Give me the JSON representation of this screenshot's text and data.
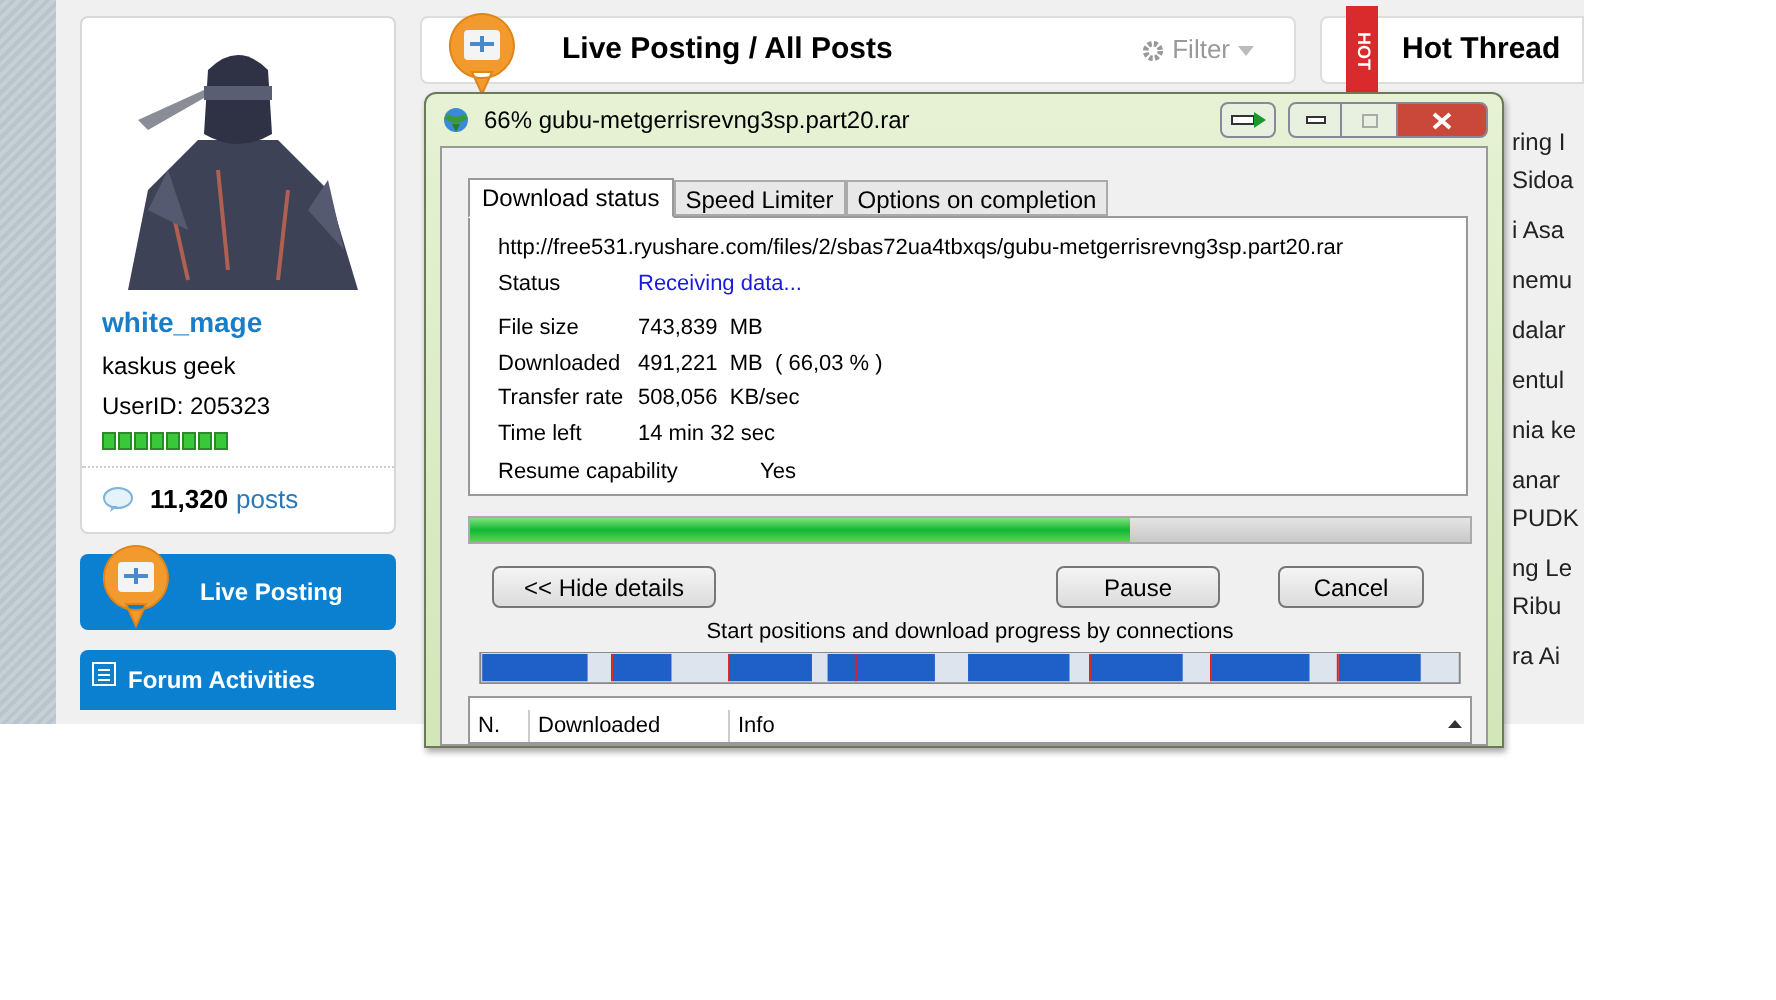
{
  "profile": {
    "username": "white_mage",
    "rank": "kaskus geek",
    "user_id": "UserID: 205323",
    "post_count": "11,320",
    "posts_label": "posts"
  },
  "sidebar_buttons": [
    {
      "label": "Live Posting",
      "kind": "live"
    },
    {
      "label": "Forum Activities",
      "kind": "forum"
    }
  ],
  "live_header": {
    "title": "Live Posting / All Posts",
    "filter": "Filter"
  },
  "hot_threads": {
    "badge": "HOT",
    "title": "Hot Thread",
    "items": [
      [
        "ring I",
        "Sidoa"
      ],
      [
        "i Asa"
      ],
      [
        "nemu"
      ],
      [
        "dalar"
      ],
      [
        "entul"
      ],
      [
        "nia ke"
      ],
      [
        "anar",
        "PUDK"
      ],
      [
        "ng Le",
        "Ribu"
      ],
      [
        "ra Ai"
      ]
    ]
  },
  "download_window": {
    "title": "66% gubu-metgerrisrevng3sp.part20.rar",
    "tabs": [
      {
        "label": "Download status",
        "selected": true
      },
      {
        "label": "Speed Limiter",
        "selected": false
      },
      {
        "label": "Options on completion",
        "selected": false
      }
    ],
    "url": "http://free531.ryushare.com/files/2/sbas72ua4tbxqs/gubu-metgerrisrevng3sp.part20.rar",
    "status_label": "Status",
    "status": "Receiving data...",
    "fields": [
      {
        "label": "File size",
        "value": "743,839  MB"
      },
      {
        "label": "Downloaded",
        "value": "491,221  MB  ( 66,03 % )"
      },
      {
        "label": "Transfer rate",
        "value": "508,056  KB/sec"
      },
      {
        "label": "Time left",
        "value": "14 min 32 sec"
      }
    ],
    "resume": {
      "label": "Resume capability",
      "value": "Yes"
    },
    "progress": {
      "level": 0.66
    },
    "buttons": [
      "<< Hide details",
      "Pause",
      "Cancel"
    ],
    "connections_label": "Start positions and download progress by connections",
    "connections_table": {
      "columns": [
        "N.",
        "Downloaded",
        "Info"
      ]
    }
  }
}
